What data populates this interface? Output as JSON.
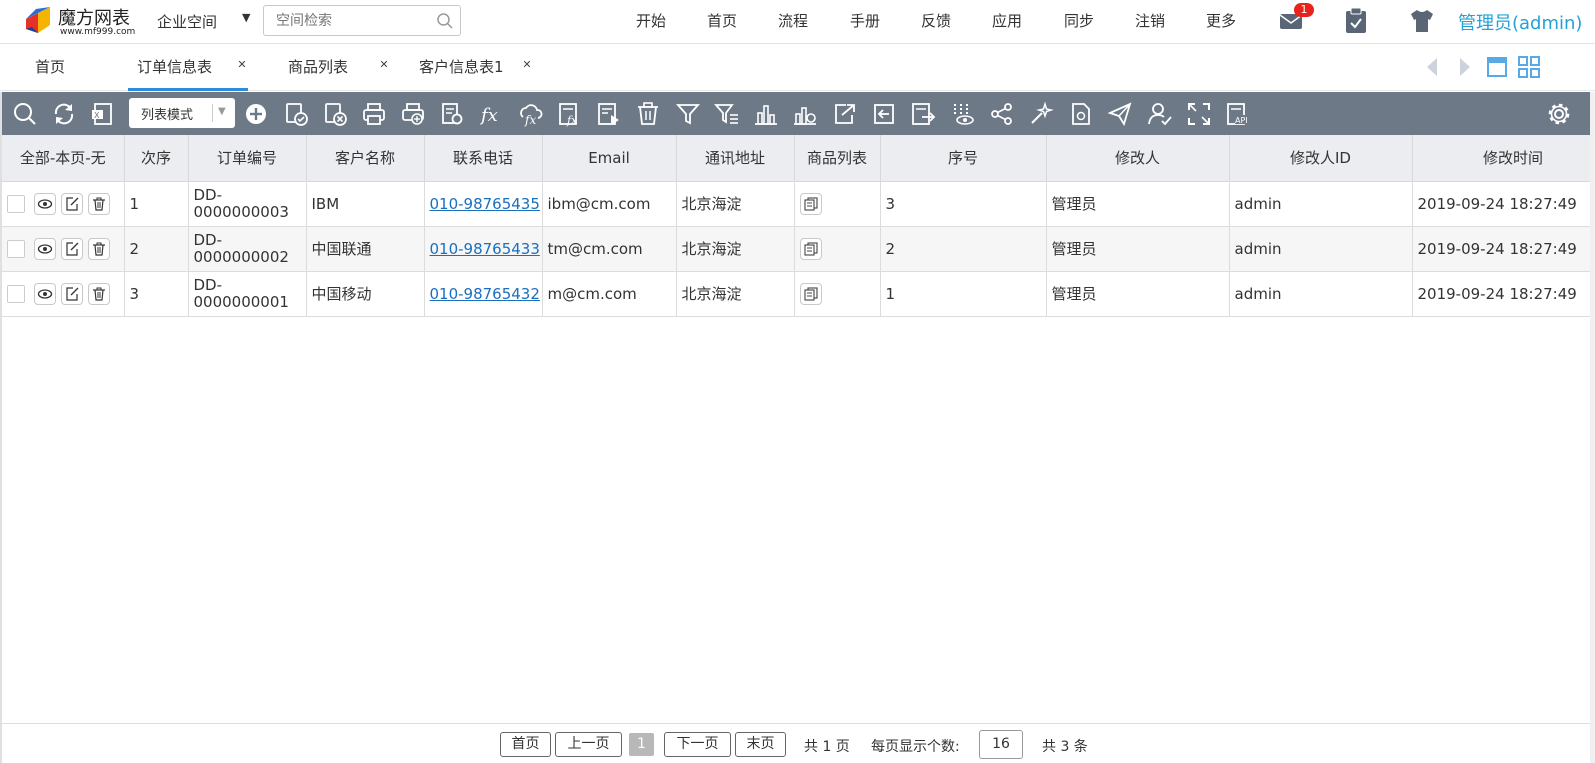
{
  "app": {
    "logo_name": "魔方网表",
    "logo_url": "www.mf999.com",
    "space_label": "企业空间",
    "search_placeholder": "空间检索"
  },
  "nav": [
    "开始",
    "首页",
    "流程",
    "手册",
    "反馈",
    "应用",
    "同步",
    "注销",
    "更多"
  ],
  "notifications": {
    "mail_count": "1"
  },
  "user": "管理员(admin)",
  "tabs": [
    {
      "label": "首页",
      "closable": false,
      "active": false
    },
    {
      "label": "订单信息表",
      "closable": true,
      "active": true
    },
    {
      "label": "商品列表",
      "closable": true,
      "active": false
    },
    {
      "label": "客户信息表1",
      "closable": true,
      "active": false
    }
  ],
  "toolbar": {
    "mode_label": "列表模式",
    "icons": [
      "search-icon",
      "refresh-icon",
      "excel-export-icon",
      "add-icon",
      "approve-icon",
      "reject-icon",
      "print-icon",
      "batch-print-icon",
      "settings-doc-icon",
      "formula-icon",
      "cloud-formula-icon",
      "excel-formula-icon",
      "run-report-icon",
      "delete-icon",
      "filter-icon",
      "advanced-filter-icon",
      "bar-chart-icon",
      "stats-chart-icon",
      "export-icon",
      "import-icon",
      "update-icon",
      "column-visibility-icon",
      "share-icon",
      "magic-icon",
      "document-icon",
      "send-icon",
      "user-assign-icon",
      "fullscreen-icon",
      "api-icon",
      "gear-icon"
    ]
  },
  "grid": {
    "columns": [
      "全部-本页-无",
      "次序",
      "订单编号",
      "客户名称",
      "联系电话",
      "Email",
      "通讯地址",
      "商品列表",
      "序号",
      "修改人",
      "修改人ID",
      "修改时间"
    ],
    "rows": [
      {
        "seq": "1",
        "order_no": "DD-0000000003",
        "customer": "IBM",
        "phone": "010-98765435",
        "email": "ibm@cm.com",
        "address": "北京海淀",
        "index": "3",
        "modifier": "管理员",
        "modifier_id": "admin",
        "modified": "2019-09-24 18:27:49"
      },
      {
        "seq": "2",
        "order_no": "DD-0000000002",
        "customer": "中国联通",
        "phone": "010-98765433",
        "email": "tm@cm.com",
        "address": "北京海淀",
        "index": "2",
        "modifier": "管理员",
        "modifier_id": "admin",
        "modified": "2019-09-24 18:27:49"
      },
      {
        "seq": "3",
        "order_no": "DD-0000000001",
        "customer": "中国移动",
        "phone": "010-98765432",
        "email": "m@cm.com",
        "address": "北京海淀",
        "index": "1",
        "modifier": "管理员",
        "modifier_id": "admin",
        "modified": "2019-09-24 18:27:49"
      }
    ]
  },
  "pager": {
    "first": "首页",
    "prev": "上一页",
    "current": "1",
    "next": "下一页",
    "last": "末页",
    "total_pages": "共 1 页",
    "page_size_label": "每页显示个数:",
    "page_size": "16",
    "total_items": "共 3 条"
  },
  "colors": {
    "accent": "#2f8ad8",
    "toolbar_bg": "#6e7987",
    "user_link": "#24a1d8",
    "badge": "#e8231b",
    "phone_link": "#1a6fbf"
  }
}
